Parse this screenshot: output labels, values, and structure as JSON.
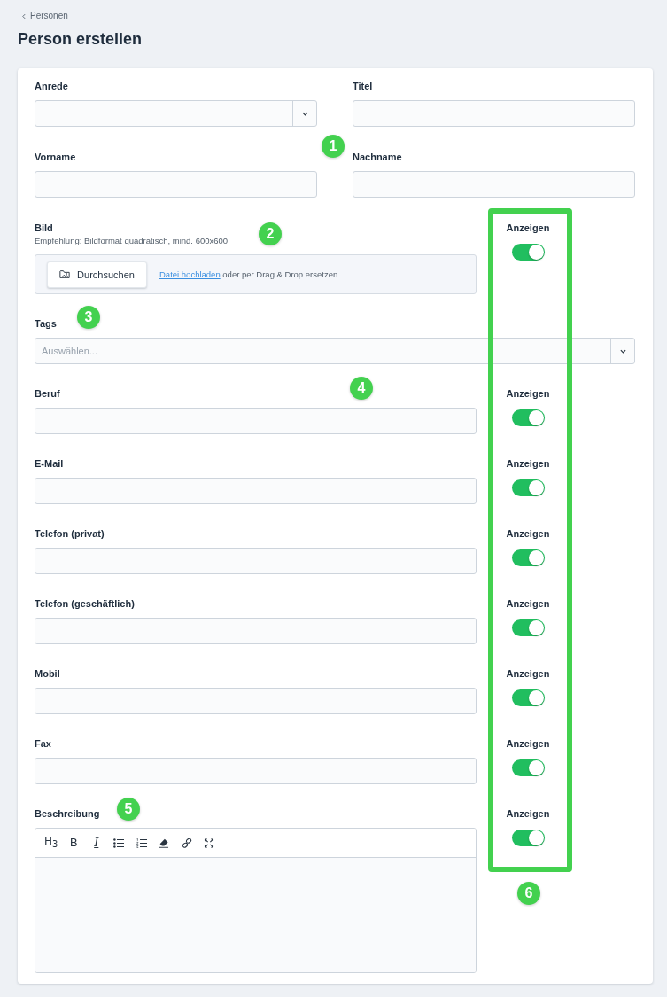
{
  "breadcrumb": {
    "label": "Personen"
  },
  "title": "Person erstellen",
  "form": {
    "top_fields": [
      {
        "label": "Anrede",
        "kind": "select"
      },
      {
        "label": "Titel",
        "kind": "text"
      },
      {
        "label": "Vorname",
        "kind": "text"
      },
      {
        "label": "Nachname",
        "kind": "text"
      }
    ],
    "image": {
      "label": "Bild",
      "hint": "Empfehlung: Bildformat quadratisch, mind. 600x600",
      "browse_button": "Durchsuchen",
      "upload_link": "Datei hochladen",
      "drop_text": "oder per Drag & Drop ersetzen.",
      "visibility": {
        "label": "Anzeigen",
        "on": true
      }
    },
    "tags": {
      "label": "Tags",
      "placeholder": "Auswählen..."
    },
    "fields": [
      {
        "label": "Beruf",
        "kind": "text",
        "visibility": {
          "label": "Anzeigen",
          "on": true
        }
      },
      {
        "label": "E-Mail",
        "kind": "text",
        "visibility": {
          "label": "Anzeigen",
          "on": true
        }
      },
      {
        "label": "Telefon (privat)",
        "kind": "text",
        "visibility": {
          "label": "Anzeigen",
          "on": true
        }
      },
      {
        "label": "Telefon (geschäftlich)",
        "kind": "text",
        "visibility": {
          "label": "Anzeigen",
          "on": true
        }
      },
      {
        "label": "Mobil",
        "kind": "text",
        "visibility": {
          "label": "Anzeigen",
          "on": true
        }
      },
      {
        "label": "Fax",
        "kind": "text",
        "visibility": {
          "label": "Anzeigen",
          "on": true
        }
      },
      {
        "label": "Beschreibung",
        "kind": "editor",
        "toolbar": [
          {
            "kind": "heading",
            "label": "H$_{3}$"
          },
          {
            "kind": "bold",
            "label": "B"
          },
          {
            "kind": "italic",
            "label": "I"
          },
          {
            "kind": "bullets"
          },
          {
            "kind": "numbers"
          },
          {
            "kind": "eraser"
          },
          {
            "kind": "link"
          },
          {
            "kind": "fullscreen"
          }
        ],
        "visibility": {
          "label": "Anzeigen",
          "on": true
        }
      }
    ]
  },
  "annotations": {
    "markers": [
      "1",
      "2",
      "3",
      "4",
      "5",
      "6"
    ],
    "highlight_frame": true
  }
}
